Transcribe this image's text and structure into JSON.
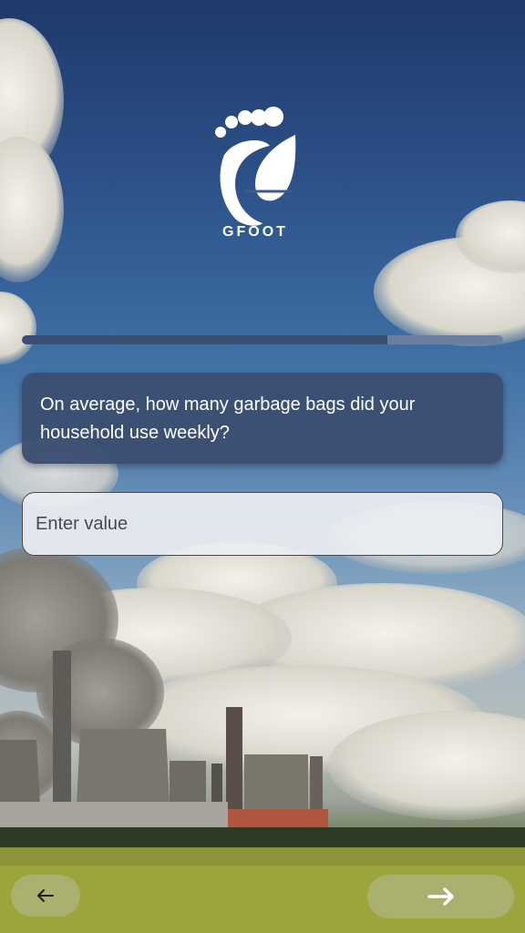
{
  "brand": {
    "name": "GFOOT",
    "logo_icon": "footprint-leaf-logo"
  },
  "progress": {
    "fraction": 0.76
  },
  "question": {
    "text": "On average, how many garbage bags did your household use weekly?"
  },
  "answer_input": {
    "placeholder": "Enter value",
    "value": ""
  },
  "navigation": {
    "back_icon": "arrow-left-icon",
    "next_icon": "arrow-right-icon"
  },
  "colors": {
    "card": "#3a4e70",
    "progress_track": "#6c7fa0",
    "progress_fill": "#3a4f73"
  }
}
